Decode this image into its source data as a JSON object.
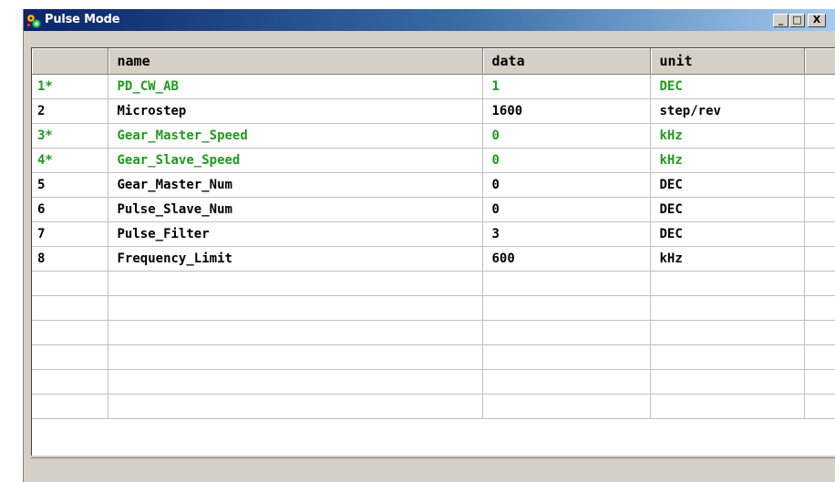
{
  "window": {
    "title": "Pulse Mode",
    "minimize_label": "_",
    "maximize_label": "□",
    "close_label": "X"
  },
  "table": {
    "columns": [
      "",
      "name",
      "data",
      "unit",
      ""
    ],
    "rows": [
      {
        "index": "1*",
        "name": "PD_CW_AB",
        "data": "1",
        "unit": "DEC",
        "highlight": true
      },
      {
        "index": "2",
        "name": "Microstep",
        "data": "1600",
        "unit": "step/rev",
        "highlight": false
      },
      {
        "index": "3*",
        "name": "Gear_Master_Speed",
        "data": "0",
        "unit": "kHz",
        "highlight": true
      },
      {
        "index": "4*",
        "name": "Gear_Slave_Speed",
        "data": "0",
        "unit": "kHz",
        "highlight": true
      },
      {
        "index": "5",
        "name": "Gear_Master_Num",
        "data": "0",
        "unit": "DEC",
        "highlight": false
      },
      {
        "index": "6",
        "name": "Pulse_Slave_Num",
        "data": "0",
        "unit": "DEC",
        "highlight": false
      },
      {
        "index": "7",
        "name": "Pulse_Filter",
        "data": "3",
        "unit": "DEC",
        "highlight": false
      },
      {
        "index": "8",
        "name": "Frequency_Limit",
        "data": "600",
        "unit": "kHz",
        "highlight": false
      }
    ],
    "empty_rows": 6
  },
  "colors": {
    "highlight_text": "#1f9a1f",
    "title_gradient_start": "#0a246a",
    "title_gradient_end": "#a6caf0"
  },
  "icons": {
    "app": "colorful-gear-icon"
  }
}
